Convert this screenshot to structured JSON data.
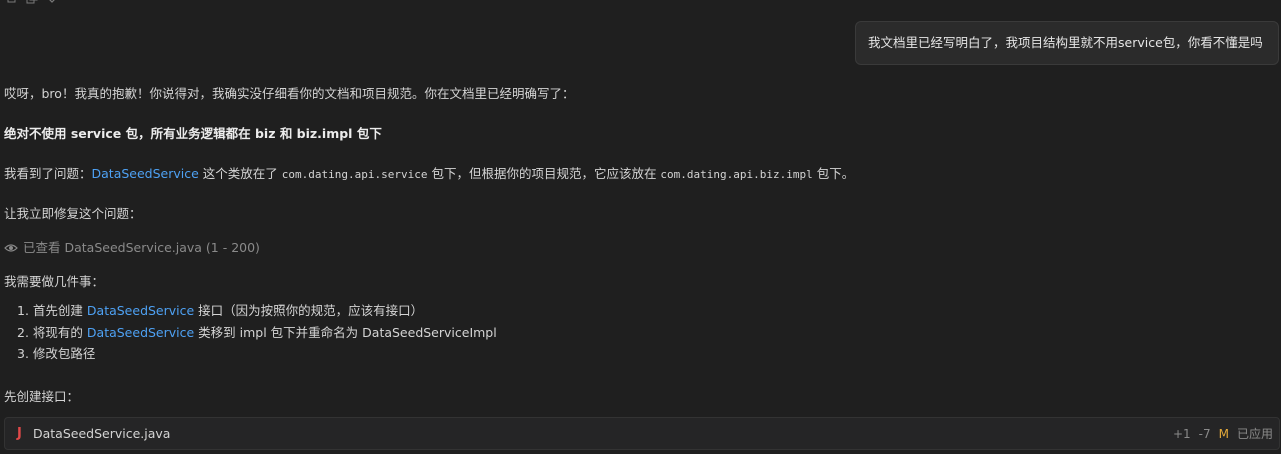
{
  "toolbar": {
    "icons": [
      "copy-icon",
      "duplicate-icon",
      "chevron-down-icon"
    ]
  },
  "user_message": "我文档里已经写明白了，我项目结构里就不用service包，你看不懂是吗",
  "assistant": {
    "p1": "哎呀，bro！我真的抱歉！你说得对，我确实没仔细看你的文档和项目规范。你在文档里已经明确写了：",
    "p2": "绝对不使用 service 包，所有业务逻辑都在 biz 和 biz.impl 包下",
    "p3": {
      "prefix": "我看到了问题：",
      "class_link": "DataSeedService",
      "mid1": " 这个类放在了 ",
      "pkg1": "com.dating.api.service",
      "mid2": " 包下，但根据你的项目规范，它应该放在 ",
      "pkg2": "com.dating.api.biz.impl",
      "suffix": " 包下。"
    },
    "p4": "让我立即修复这个问题：",
    "viewed": "已查看 DataSeedService.java (1 - 200)",
    "p5": "我需要做几件事：",
    "list": [
      {
        "num": "1.",
        "pre": "首先创建 ",
        "link": "DataSeedService",
        "post": " 接口（因为按照你的规范，应该有接口）"
      },
      {
        "num": "2.",
        "pre": "将现有的 ",
        "link": "DataSeedService",
        "post": " 类移到 impl 包下并重命名为 DataSeedServiceImpl"
      },
      {
        "num": "3.",
        "pre": "修改包路径",
        "link": "",
        "post": ""
      }
    ],
    "p6": "先创建接口："
  },
  "file_card": {
    "icon": "java-icon",
    "icon_glyph": "J",
    "filename": "DataSeedService.java",
    "diff_added": "+1",
    "diff_removed": "-7",
    "status_badge": "M",
    "status_text": "已应用"
  },
  "colors": {
    "background": "#1f1f1f",
    "link": "#4ea1f3",
    "modified": "#e2a93b",
    "java_icon": "#e04848"
  }
}
